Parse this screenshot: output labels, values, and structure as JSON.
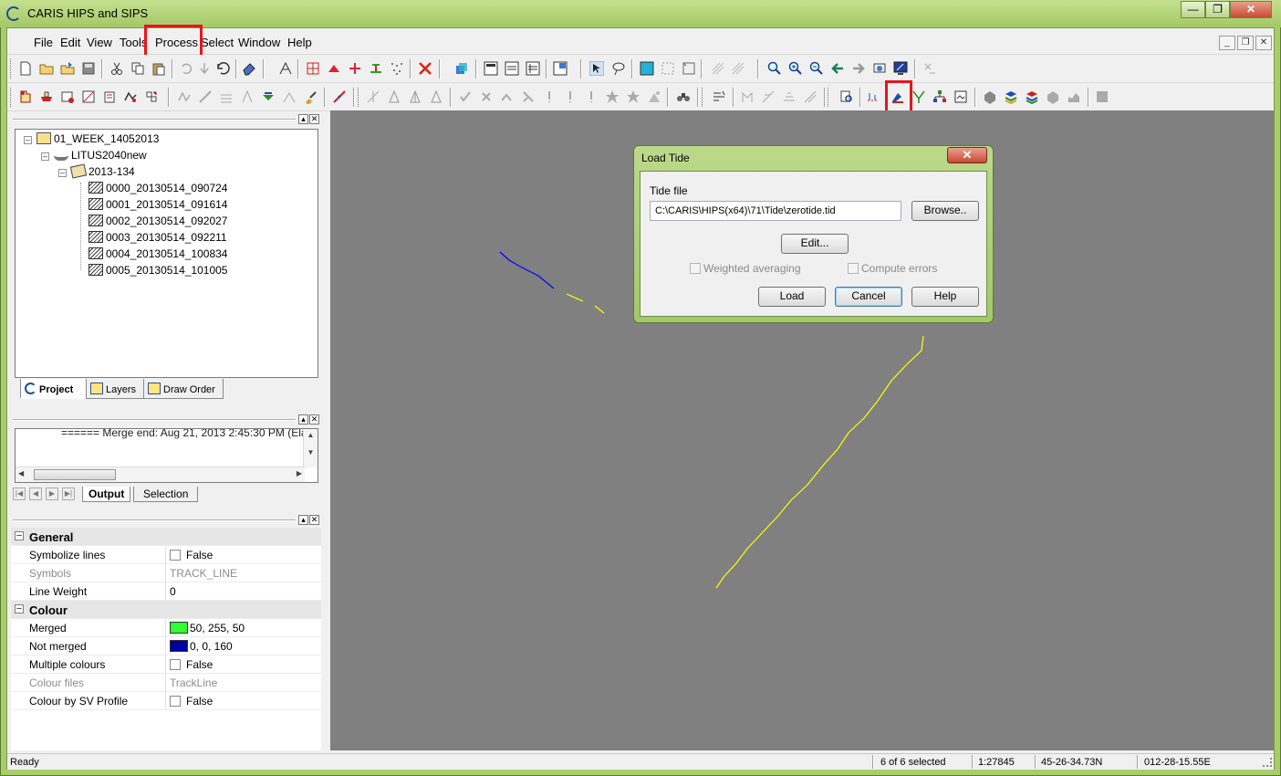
{
  "window": {
    "title": "CARIS HIPS and SIPS",
    "controls": [
      "—",
      "❐",
      "✕"
    ]
  },
  "menu": {
    "items": [
      "File",
      "Edit",
      "View",
      "Tools",
      "Process",
      "Select",
      "Window",
      "Help"
    ],
    "mdi_controls": [
      "_",
      "❐",
      "✕"
    ]
  },
  "tree": {
    "project": "01_WEEK_14052013",
    "vessel": "LITUS2040new",
    "day": "2013-134",
    "lines": [
      "0000_20130514_090724",
      "0001_20130514_091614",
      "0002_20130514_092027",
      "0003_20130514_092211",
      "0004_20130514_100834",
      "0005_20130514_101005"
    ]
  },
  "panel_tabs": [
    "Project",
    "Layers",
    "Draw Order"
  ],
  "output": {
    "text": "====== Merge end: Aug 21, 2013 2:45:30 PM (Ela",
    "tabs": [
      "Output",
      "Selection"
    ]
  },
  "properties": {
    "general_label": "General",
    "colour_label": "Colour",
    "rows": [
      {
        "key": "Symbolize lines",
        "value": "False"
      },
      {
        "key": "Symbols",
        "value": "TRACK_LINE"
      },
      {
        "key": "Line Weight",
        "value": "0"
      },
      {
        "key": "Merged",
        "value": "50, 255, 50"
      },
      {
        "key": "Not merged",
        "value": "0, 0, 160"
      },
      {
        "key": "Multiple colours",
        "value": "False"
      },
      {
        "key": "Colour files",
        "value": "TrackLine"
      },
      {
        "key": "Colour by SV Profile",
        "value": "False"
      }
    ],
    "merged_color": "#32ff32",
    "not_merged_color": "#0000a0"
  },
  "dialog": {
    "title": "Load Tide",
    "close": "✕",
    "tide_file_label": "Tide file",
    "tide_file_value": "C:\\CARIS\\HIPS(x64)\\71\\Tide\\zerotide.tid",
    "browse": "Browse..",
    "edit": "Edit...",
    "weighted_averaging": "Weighted averaging",
    "compute_errors": "Compute errors",
    "load": "Load",
    "cancel": "Cancel",
    "help": "Help"
  },
  "status": {
    "ready": "Ready",
    "selected": "6 of 6 selected",
    "scale": "1:27845",
    "latitude": "45-26-34.73N",
    "longitude": "012-28-15.55E"
  },
  "colors": {
    "highlight": "#e8141b",
    "track_merged": "#ffff00",
    "track_not_merged": "#0000ff"
  }
}
